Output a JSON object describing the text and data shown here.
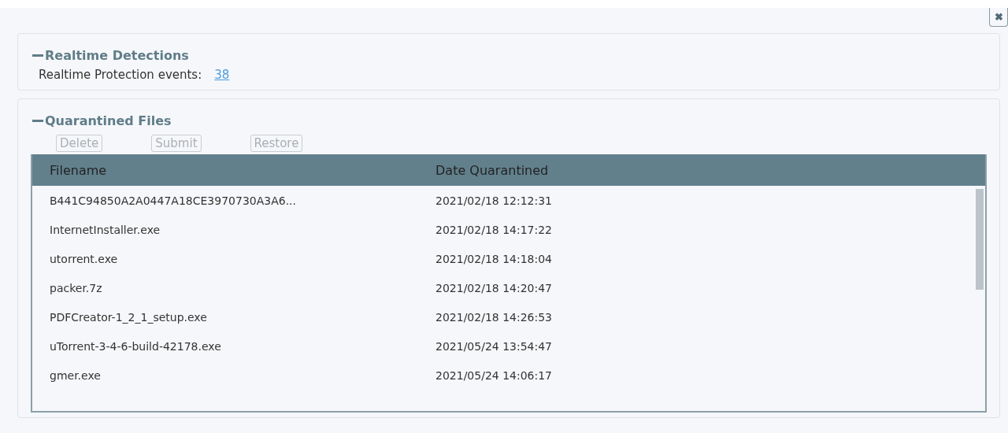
{
  "close_button": {
    "label": "✖"
  },
  "realtime": {
    "title": "Realtime Detections",
    "expanded": true,
    "label": "Realtime Protection events:",
    "count_link": "38"
  },
  "quarantine": {
    "title": "Quarantined Files",
    "expanded": true,
    "buttons": [
      {
        "label": "Delete",
        "disabled": true
      },
      {
        "label": "Submit",
        "disabled": true
      },
      {
        "label": "Restore",
        "disabled": true
      }
    ],
    "table": {
      "columns": [
        "Filename",
        "Date Quarantined"
      ],
      "rows": [
        [
          "B441C94850A2A0447A18CE3970730A3A6...",
          "2021/02/18 12:12:31"
        ],
        [
          "InternetInstaller.exe",
          "2021/02/18 14:17:22"
        ],
        [
          "utorrent.exe",
          "2021/02/18 14:18:04"
        ],
        [
          "packer.7z",
          "2021/02/18 14:20:47"
        ],
        [
          "PDFCreator-1_2_1_setup.exe",
          "2021/02/18 14:26:53"
        ],
        [
          "uTorrent-3-4-6-build-42178.exe",
          "2021/05/24 13:54:47"
        ],
        [
          "gmer.exe",
          "2021/05/24 14:06:17"
        ]
      ]
    }
  }
}
